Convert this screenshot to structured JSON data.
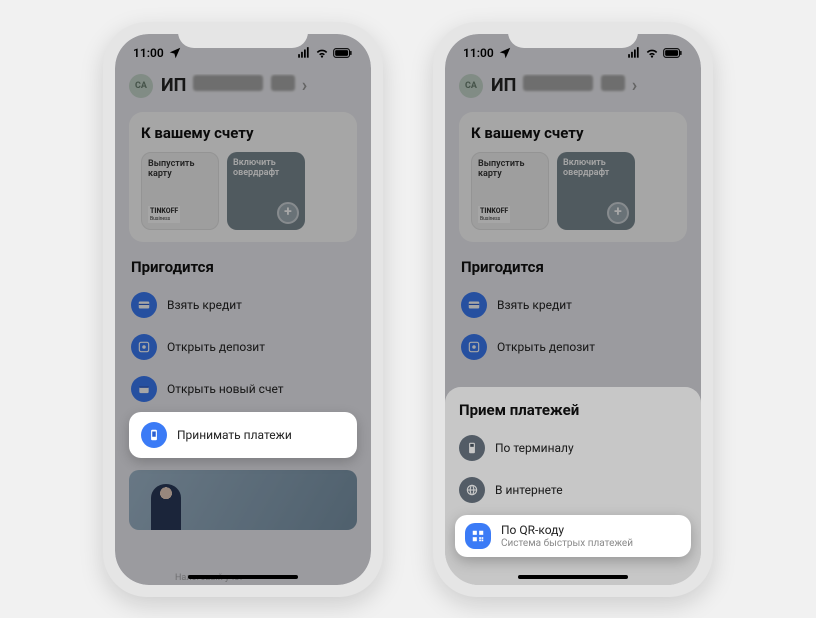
{
  "status": {
    "time": "11:00",
    "location_icon": "location",
    "right": [
      "signal",
      "wifi",
      "battery"
    ]
  },
  "header": {
    "avatar_initials": "СА",
    "title_prefix": "ИП",
    "title_blur1": "С",
    "title_blur2": "В.",
    "chevron": "›"
  },
  "account_section": {
    "title": "К вашему счету",
    "tiles": [
      {
        "line1": "Выпустить",
        "line2": "карту",
        "brand_top": "TINKOFF",
        "brand_bottom": "Business"
      },
      {
        "line1": "Включить",
        "line2": "овердрафт"
      }
    ]
  },
  "useful_section": {
    "title": "Пригодится",
    "items": [
      {
        "icon": "credit",
        "label": "Взять кредит"
      },
      {
        "icon": "deposit",
        "label": "Открыть депозит"
      },
      {
        "icon": "account",
        "label": "Открыть новый счет"
      },
      {
        "icon": "payments",
        "label": "Принимать платежи"
      }
    ]
  },
  "footer": {
    "caption": "Налоговый учет"
  },
  "sheet": {
    "title": "Прием платежей",
    "items": [
      {
        "icon": "terminal",
        "label": "По терминалу",
        "sublabel": ""
      },
      {
        "icon": "internet",
        "label": "В интернете",
        "sublabel": ""
      },
      {
        "icon": "qr",
        "label": "По QR-коду",
        "sublabel": "Система быстрых платежей"
      }
    ]
  },
  "phone2_useful_visible": [
    {
      "icon": "credit",
      "label": "Взять кредит"
    },
    {
      "icon": "deposit",
      "label": "Открыть депозит"
    }
  ]
}
